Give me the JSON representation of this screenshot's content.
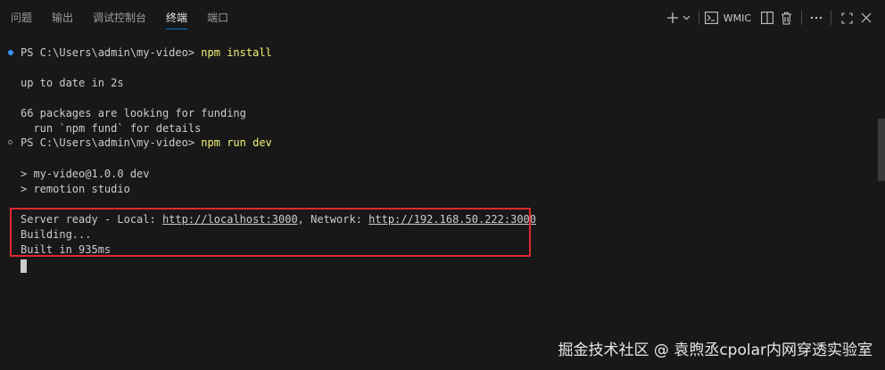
{
  "tabs": [
    {
      "label": "问题"
    },
    {
      "label": "输出"
    },
    {
      "label": "调试控制台"
    },
    {
      "label": "终端",
      "active": true
    },
    {
      "label": "端口"
    }
  ],
  "toolbar": {
    "shell_label": "WMIC",
    "icons": [
      "plus-icon",
      "chevron-down-icon",
      "terminal-icon",
      "split-icon",
      "trash-icon",
      "more-icon",
      "maximize-icon",
      "close-icon"
    ]
  },
  "terminal": {
    "lines": {
      "cmd1_prompt": "PS C:\\Users\\admin\\my-video> ",
      "cmd1_command": "npm install",
      "uptodate": "up to date in 2s",
      "funding1": "66 packages are looking for funding",
      "funding2": "  run `npm fund` for details",
      "cmd2_prompt": "PS C:\\Users\\admin\\my-video> ",
      "cmd2_command": "npm run dev",
      "script1": "> my-video@1.0.0 dev",
      "script2": "> remotion studio",
      "server_prefix": "Server ready - Local: ",
      "local_url": "http://localhost:3000",
      "network_prefix": ", Network: ",
      "network_url": "http://192.168.50.222:3000",
      "building": "Building...",
      "built": "Built in 935ms"
    }
  },
  "colors": {
    "background": "#181818",
    "command": "#f2f27a",
    "text": "#cccccc",
    "highlight": "#e0272e",
    "accent": "#0078d4",
    "success_dot": "#3794ff"
  },
  "watermark": "掘金技术社区 @ 袁煦丞cpolar内网穿透实验室"
}
